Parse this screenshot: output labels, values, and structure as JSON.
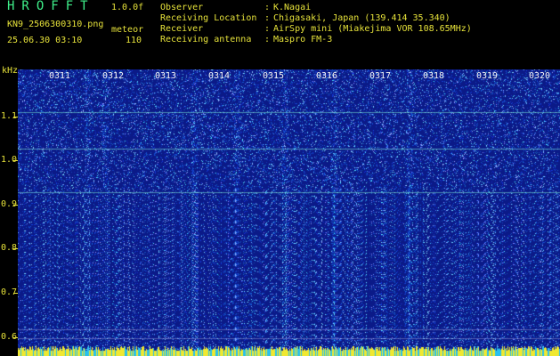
{
  "app": {
    "title": "HROFFT",
    "version": "1.0.0f"
  },
  "file": {
    "name": "KN9_2506300310.png",
    "datetime": "25.06.30 03:10"
  },
  "meteor": {
    "label": "meteor",
    "count": "110"
  },
  "info": [
    {
      "label": "Observer",
      "value": "K.Nagai"
    },
    {
      "label": "Receiving Location",
      "value": "Chigasaki, Japan (139.414 35.340)"
    },
    {
      "label": "Receiver",
      "value": "AirSpy mini (Miakejima VOR 108.65MHz)"
    },
    {
      "label": "Receiving antenna",
      "value": "Maspro FM-3"
    }
  ],
  "axis": {
    "y_unit": "kHz",
    "y_ticks": [
      "1.1",
      "1.0",
      "0.9",
      "0.8",
      "0.7",
      "0.6"
    ],
    "time_ticks": [
      "0311",
      "0312",
      "0313",
      "0314",
      "0315",
      "0316",
      "0317",
      "0318",
      "0319",
      "0320"
    ]
  },
  "colors": {
    "background": "#000000",
    "text": "#e6e23a",
    "title": "#3ff08a",
    "spectrum_base": "#0b1a88",
    "signal_line": "#7ff0d8",
    "noise_bar": "#f0e830"
  }
}
